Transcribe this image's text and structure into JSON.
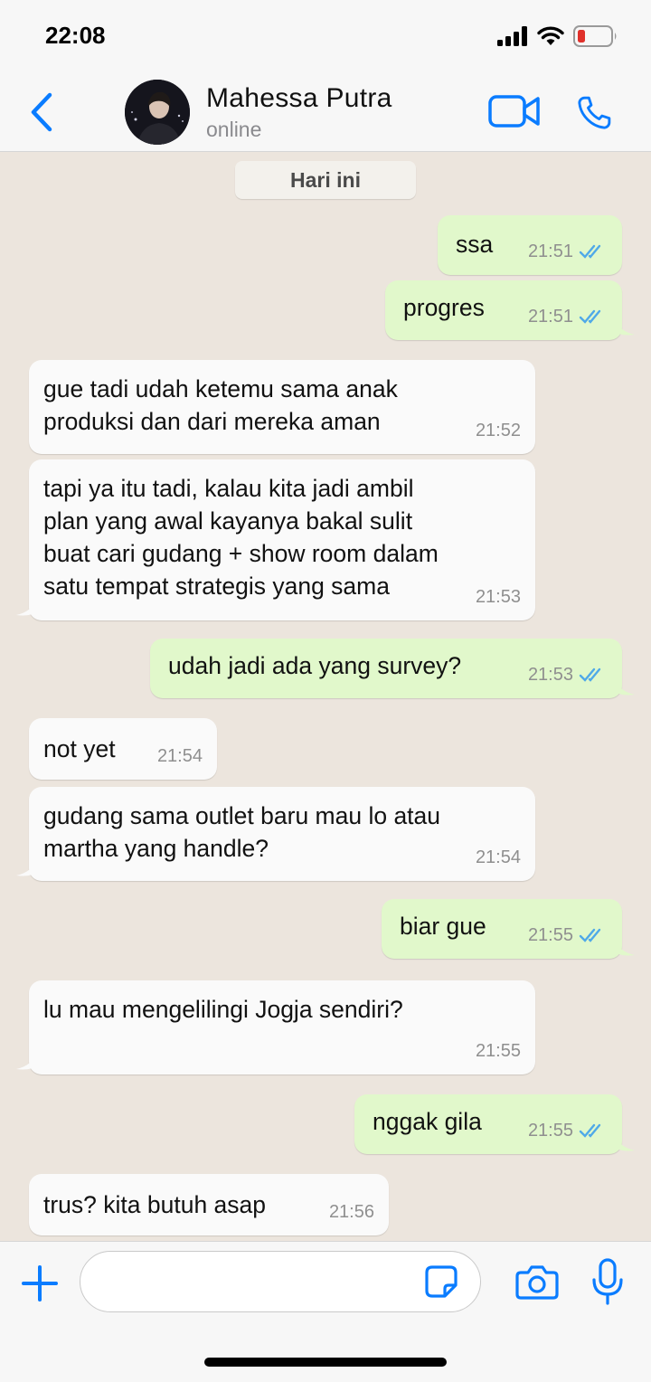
{
  "status_bar": {
    "time": "22:08"
  },
  "header": {
    "contact_name": "Mahessa Putra",
    "contact_status": "online"
  },
  "chat": {
    "date_label": "Hari ini",
    "messages": [
      {
        "dir": "out",
        "text": "ssa",
        "time": "21:51",
        "read": true
      },
      {
        "dir": "out",
        "text": "progres",
        "time": "21:51",
        "read": true
      },
      {
        "dir": "in",
        "text": "gue tadi udah ketemu sama anak\nproduksi dan dari mereka aman",
        "time": "21:52"
      },
      {
        "dir": "in",
        "text": "tapi ya itu tadi, kalau kita jadi ambil\nplan yang awal kayanya bakal sulit\nbuat cari gudang + show room dalam\nsatu tempat strategis yang sama",
        "time": "21:53"
      },
      {
        "dir": "out",
        "text": "udah jadi ada yang survey?",
        "time": "21:53",
        "read": true
      },
      {
        "dir": "in",
        "text": "not yet",
        "time": "21:54"
      },
      {
        "dir": "in",
        "text": "gudang sama outlet baru mau lo atau\nmartha yang handle?",
        "time": "21:54"
      },
      {
        "dir": "out",
        "text": "biar gue",
        "time": "21:55",
        "read": true
      },
      {
        "dir": "in",
        "text": "lu mau mengelilingi Jogja sendiri?",
        "time": "21:55"
      },
      {
        "dir": "out",
        "text": "nggak gila",
        "time": "21:55",
        "read": true
      },
      {
        "dir": "in",
        "text": "trus? kita butuh asap",
        "time": "21:56"
      }
    ]
  },
  "input": {
    "placeholder": "",
    "value": ""
  },
  "colors": {
    "accent": "#0a7cff",
    "chat_bg": "#ece5dd",
    "incoming_bubble": "#fafafa",
    "outgoing_bubble": "#e1f8cb",
    "read_tick": "#4fa9e8",
    "battery_low": "#e0312b"
  },
  "icons": [
    "back-chevron-icon",
    "video-call-icon",
    "phone-icon",
    "plus-icon",
    "sticker-icon",
    "camera-icon",
    "microphone-icon",
    "signal-icon",
    "wifi-icon",
    "battery-icon"
  ]
}
